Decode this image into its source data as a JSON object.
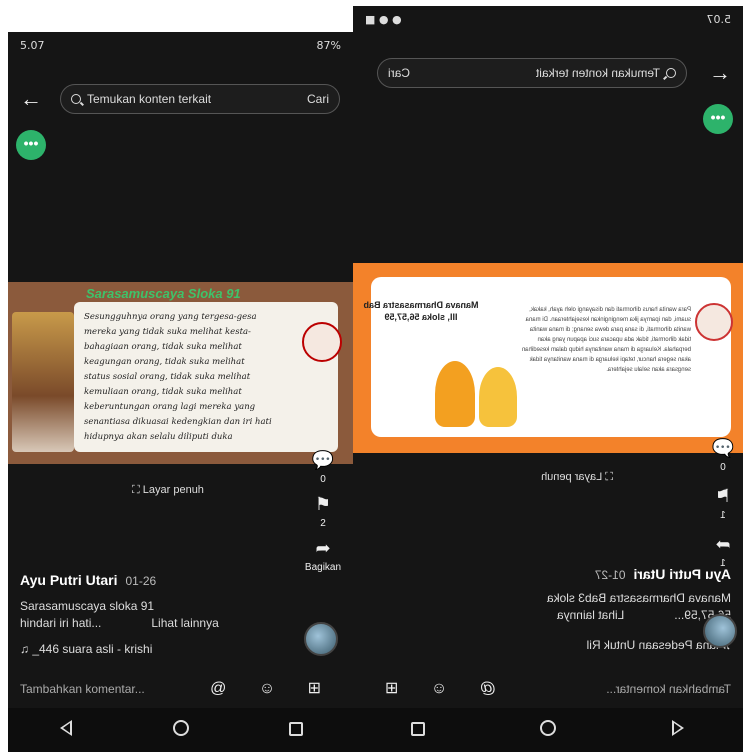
{
  "left": {
    "status": {
      "time": "5.07",
      "right": "87%"
    },
    "search": {
      "placeholder": "Temukan konten terkait",
      "button": "Cari"
    },
    "more_label": "•••",
    "slide": {
      "title": "Sarasamuscaya Sloka 91",
      "text": [
        "Sesungguhnya orang yang tergesa-gesa",
        "mereka yang tidak suka melihat kesta-",
        "bahagiaan orang, tidak suka melihat",
        "keagungan orang, tidak suka melihat",
        "status sosial orang, tidak suka melihat",
        "kemuliaan orang, tidak suka melihat",
        "keberuntungan orang lagi mereka yang",
        "senantiasa dikuasai kedengkian dan iri hati",
        "hidupnya akan selalu diliputi duka"
      ]
    },
    "fullscreen": "Layar penuh",
    "sidebar": {
      "comments": "0",
      "saves": "2",
      "share": "Bagikan"
    },
    "author": "Ayu Putri Utari",
    "date": "01-26",
    "desc_line1": "Sarasamuscaya sloka 91",
    "desc_line2": "hindari iri hati...",
    "see_more": "Lihat lainnya",
    "music": "♫ _446   suara asli - krishi",
    "comment_placeholder": "Tambahkan komentar...",
    "comment_icons": "@ ☺ ⊞"
  },
  "right": {
    "status": {
      "time": "5.07"
    },
    "search": {
      "placeholder": "Temukan konten terkait",
      "button": "Cari"
    },
    "more_label": "•••",
    "slide": {
      "title": "Manava Dharmasastra Bab III, sloka 56,57,59",
      "text": "Para wanita harus dihormati dan disayangi oleh ayah, kakak, suami, dan iparnya jika menginginkan kesejahteraan. Di mana wanita dihormati, di sana para dewa senang; di mana wanita tidak dihormati, tidak ada upacara suci apapun yang akan berpahala. Keluarga di mana wanitanya hidup dalam kesedihan akan segera hancur, tetapi keluarga di mana wanitanya tidak sengsara akan selalu sejahtera."
    },
    "fullscreen": "Layar penuh",
    "sidebar": {
      "comments": "0",
      "saves": "1",
      "share": "1"
    },
    "author": "Ayu Putri Utari",
    "date": "01-27",
    "desc_line1": "Manava Dharmasastra Bab3 sloka",
    "desc_line2": "56,57,59...",
    "see_more": "Lihat lainnya",
    "music": "♫ iana Pedesaan Untuk Ril",
    "comment_placeholder": "Tambahkan komentar...",
    "comment_icons": "@ ☺ ⊞"
  }
}
